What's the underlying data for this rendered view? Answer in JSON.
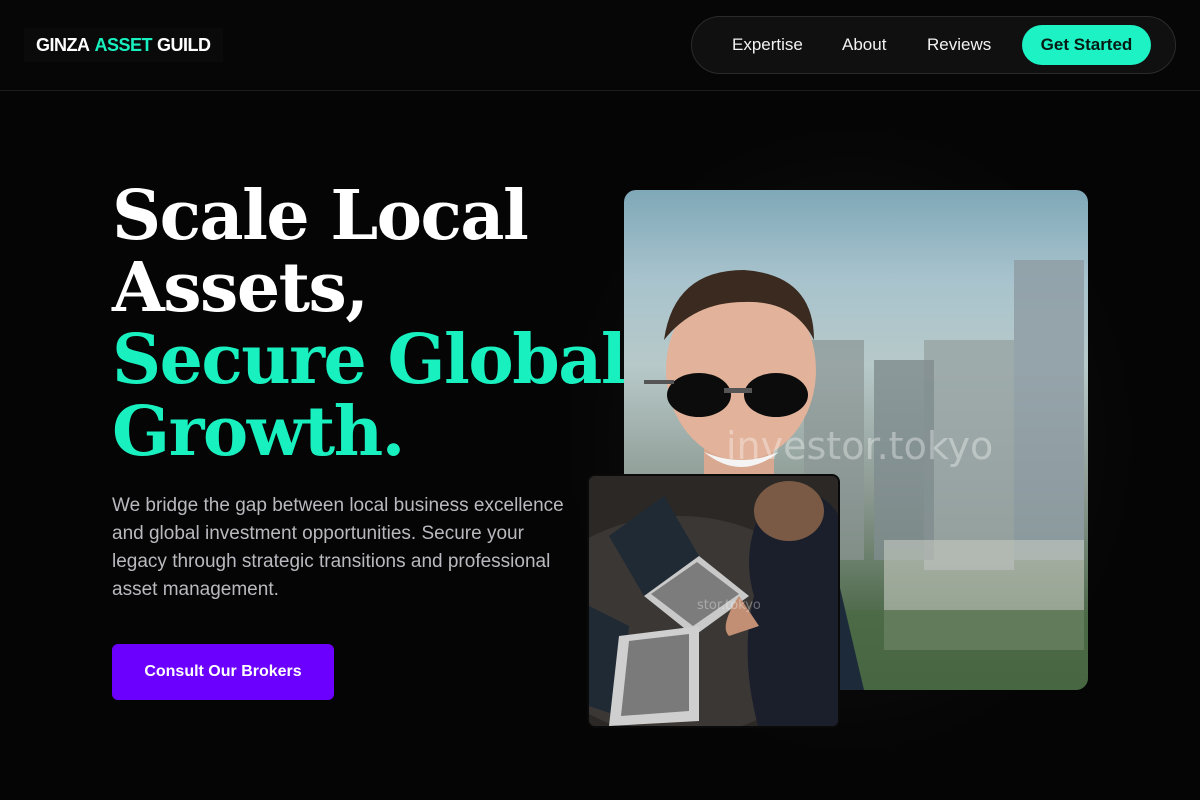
{
  "brand": {
    "part1": "GINZA",
    "part2": "ASSET",
    "part3": "GUILD"
  },
  "nav": {
    "links": [
      "Expertise",
      "About",
      "Reviews"
    ],
    "cta": "Get Started"
  },
  "hero": {
    "title_lines": [
      "Scale Local",
      "Assets,"
    ],
    "title_accent_lines": [
      "Secure Global",
      "Growth."
    ],
    "description": "We bridge the gap between local business excellence and global investment opportunities. Secure your legacy through strategic transitions and professional asset management.",
    "cta": "Consult Our Brokers"
  },
  "images": {
    "main_watermark": "investor.tokyo",
    "small_watermark": "stor.tokyo"
  },
  "colors": {
    "accent": "#19f0c0",
    "cta": "#6b00ff",
    "background": "#050505"
  }
}
